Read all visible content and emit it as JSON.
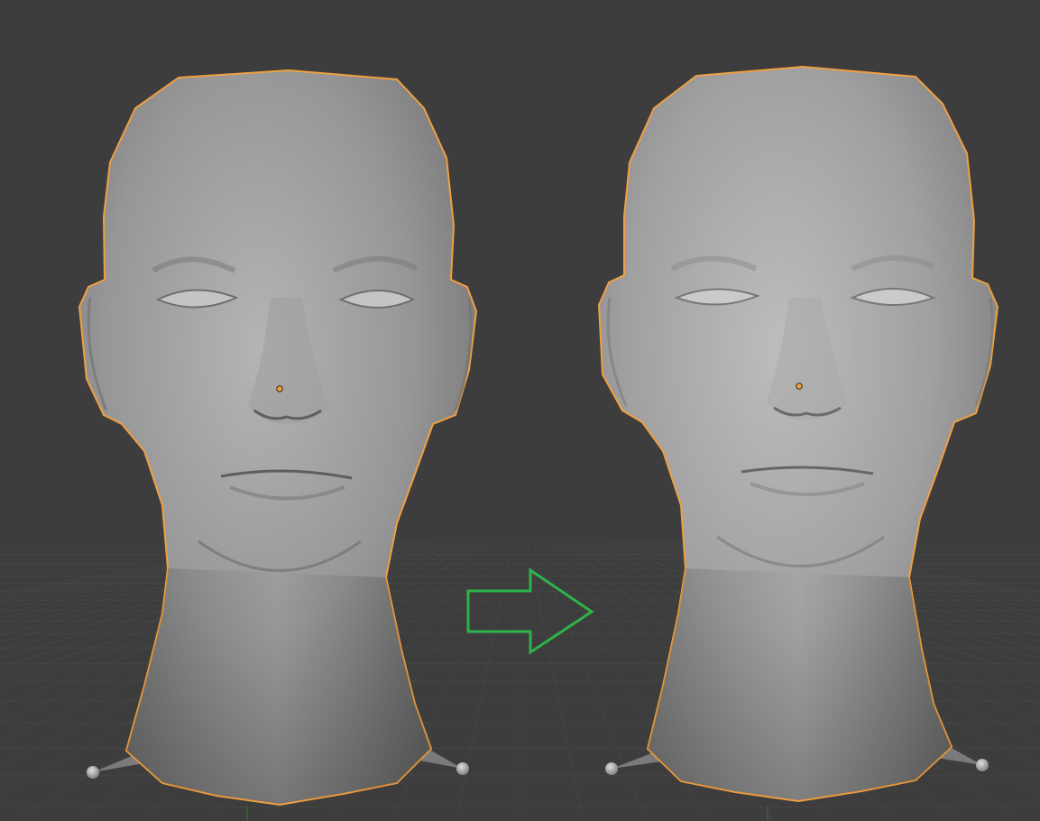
{
  "viewport": {
    "background_color": "#3d3d3d",
    "grid_color": "#4a4a4a",
    "axis_color": "#3a5a35"
  },
  "models": [
    {
      "id": "head-before",
      "state": "before",
      "selected": true,
      "outline_color": "#f0a040",
      "skin_color": "#8e8e8e"
    },
    {
      "id": "head-after",
      "state": "after",
      "selected": true,
      "outline_color": "#f0a040",
      "skin_color": "#9a9a9a"
    }
  ],
  "transition_arrow": {
    "icon": "right-arrow-icon",
    "color": "#2db34a"
  }
}
